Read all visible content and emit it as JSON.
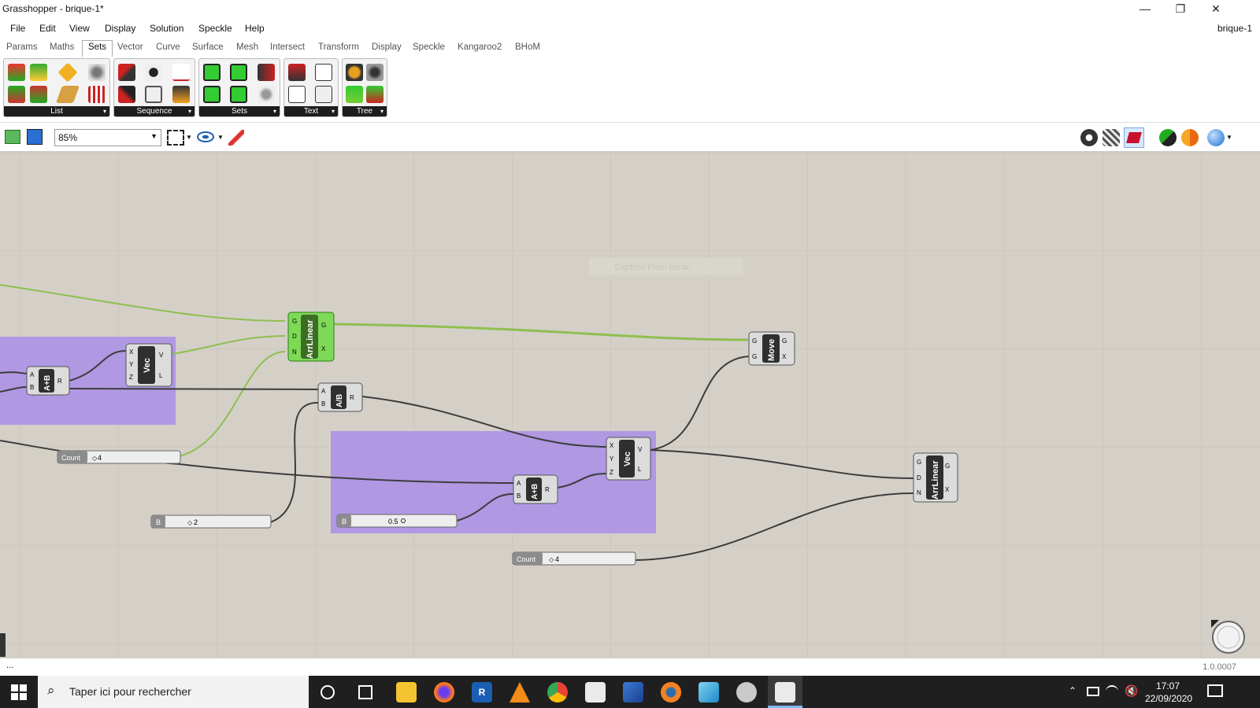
{
  "window": {
    "title": "Grasshopper - brique-1*",
    "minimize": "—",
    "restore": "❐",
    "close": "✕"
  },
  "menubar": {
    "items": [
      "File",
      "Edit",
      "View",
      "Display",
      "Solution",
      "Speckle",
      "Help"
    ],
    "doc_name": "brique-1"
  },
  "tabs": {
    "items": [
      "Params",
      "Maths",
      "Sets",
      "Vector",
      "Curve",
      "Surface",
      "Mesh",
      "Intersect",
      "Transform",
      "Display",
      "Speckle",
      "Kangaroo2",
      "BHoM"
    ],
    "active": "Sets"
  },
  "ribbon": {
    "panels": [
      "List",
      "Sequence",
      "Sets",
      "Text",
      "Tree"
    ],
    "expander": "▾"
  },
  "toolbar": {
    "zoom": "85%"
  },
  "canvas": {
    "ghost_text": "Capture Plein écran",
    "components": {
      "arrlinear_1": {
        "name": "ArrLinear",
        "inputs": [
          "G",
          "D",
          "N"
        ],
        "outputs": [
          "G",
          "X"
        ]
      },
      "arrlinear_2": {
        "name": "ArrLinear",
        "inputs": [
          "G",
          "D",
          "N"
        ],
        "outputs": [
          "G",
          "X"
        ]
      },
      "move": {
        "name": "Move",
        "inputs": [
          "G",
          "T"
        ],
        "outputs": [
          "G",
          "X"
        ]
      },
      "vec_1": {
        "name": "Vec",
        "inputs": [
          "X",
          "Y",
          "Z"
        ],
        "outputs": [
          "V",
          "L"
        ]
      },
      "vec_2": {
        "name": "Vec",
        "inputs": [
          "X",
          "Y",
          "Z"
        ],
        "outputs": [
          "V",
          "L"
        ]
      },
      "add_1": {
        "name": "A+B",
        "inputs": [
          "A",
          "B"
        ],
        "outputs": [
          "R"
        ]
      },
      "add_2": {
        "name": "A+B",
        "inputs": [
          "A",
          "B"
        ],
        "outputs": [
          "R"
        ]
      },
      "div": {
        "name": "A/B",
        "inputs": [
          "A",
          "B"
        ],
        "outputs": [
          "R"
        ]
      }
    },
    "sliders": {
      "count_1": {
        "label": "Count",
        "value": "4"
      },
      "count_2": {
        "label": "Count",
        "value": "4"
      },
      "b_1": {
        "label": "B",
        "value": "2"
      },
      "b_2": {
        "label": "B",
        "value": "0.5"
      }
    }
  },
  "status": {
    "left": "...",
    "version": "1.0.0007"
  },
  "taskbar": {
    "search_placeholder": "Taper ici pour rechercher",
    "time": "17:07",
    "date": "22/09/2020"
  },
  "colors": {
    "canvas": "#d4d0c8",
    "group": "#a98ee8",
    "selected": "#7ed957",
    "wire": "#3c3c3c",
    "wire_selected": "#8fbf4f"
  }
}
